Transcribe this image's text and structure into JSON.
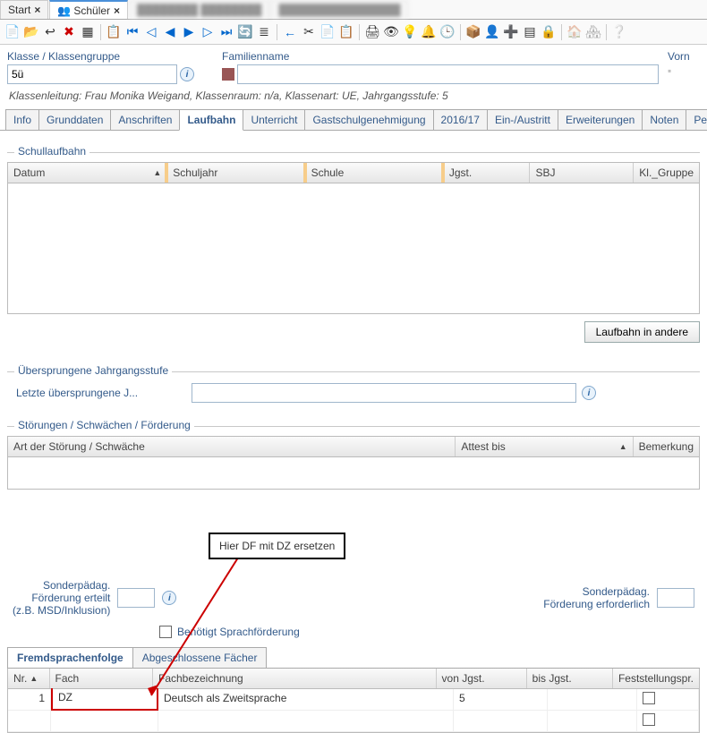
{
  "top_tabs": {
    "items": [
      {
        "label": "Start",
        "closable": true,
        "icon": "",
        "active": false,
        "blur": false
      },
      {
        "label": "Schüler",
        "closable": true,
        "icon": "people",
        "active": true,
        "blur": false
      },
      {
        "label": "████████ ████████",
        "closable": false,
        "icon": "",
        "active": false,
        "blur": true
      },
      {
        "label": "████████████████",
        "closable": false,
        "icon": "",
        "active": false,
        "blur": true
      }
    ]
  },
  "filters": {
    "klasse": {
      "label": "Klasse / Klassengruppe",
      "value": "5ü"
    },
    "familienname": {
      "label": "Familienname",
      "value": ""
    },
    "vorname": {
      "label": "Vorn"
    }
  },
  "meta": "Klassenleitung: Frau Monika Weigand, Klassenraum: n/a, Klassenart: UE, Jahrgangsstufe: 5",
  "mid_tabs": [
    "Info",
    "Grunddaten",
    "Anschriften",
    "Laufbahn",
    "Unterricht",
    "Gastschulgenehmigung",
    "2016/17",
    "Ein-/Austritt",
    "Erweiterungen",
    "Noten",
    "Person"
  ],
  "mid_tab_active": 3,
  "schullaufbahn": {
    "title": "Schullaufbahn",
    "columns": [
      "Datum",
      "Schuljahr",
      "Schule",
      "Jgst.",
      "SBJ",
      "Kl._Gruppe"
    ],
    "btn": "Laufbahn in andere"
  },
  "uebersprungen": {
    "title": "Übersprungene Jahrgangsstufe",
    "label": "Letzte übersprungene J...",
    "value": ""
  },
  "stoerungen": {
    "title": "Störungen / Schwächen / Förderung",
    "columns": [
      "Art der Störung / Schwäche",
      "Attest bis",
      "Bemerkung"
    ]
  },
  "foerderung": {
    "erteilt_label_l1": "Sonderpädag.",
    "erteilt_label_l2": "Förderung erteilt",
    "erteilt_label_l3": "(z.B. MSD/Inklusion)",
    "erteilt_value": "",
    "erforderlich_label_l1": "Sonderpädag.",
    "erforderlich_label_l2": "Förderung erforderlich",
    "erforderlich_value": "",
    "chk_label": "Benötigt Sprachförderung"
  },
  "note": "Hier DF mit DZ ersetzen",
  "small_tabs": [
    "Fremdsprachenfolge",
    "Abgeschlossene Fächer"
  ],
  "small_tab_active": 0,
  "fremdsprachen": {
    "columns": [
      "Nr.",
      "Fach",
      "Fachbezeichnung",
      "von Jgst.",
      "bis Jgst.",
      "Feststellungspr."
    ],
    "rows": [
      {
        "nr": "1",
        "fach": "DZ",
        "bez": "Deutsch als Zweitsprache",
        "von": "5",
        "bis": "",
        "fest": false
      },
      {
        "nr": "",
        "fach": "",
        "bez": "",
        "von": "",
        "bis": "",
        "fest": false
      }
    ]
  },
  "icons": {
    "new": "📄",
    "open": "📂",
    "undo": "↩",
    "delete": "✖",
    "table": "▦",
    "clip": "📋",
    "first": "⏮",
    "prev": "◀",
    "prevfast": "◁",
    "next": "▶",
    "nextfast": "▷",
    "last": "⏭",
    "refresh": "🔄",
    "list": "≣",
    "back": "←",
    "cut": "✂",
    "copy": "📄",
    "paste": "📋",
    "print": "🖨",
    "eye": "👁",
    "bulb": "💡",
    "bell": "🔔",
    "clock": "🕒",
    "box1": "📦",
    "person": "👤",
    "plus": "➕",
    "grid": "▤",
    "lock": "🔒",
    "home": "🏠",
    "homes": "🏘",
    "help": "❔"
  }
}
